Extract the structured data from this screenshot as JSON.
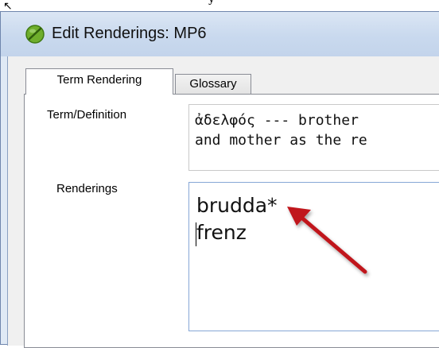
{
  "window": {
    "title": "Edit Renderings: MP6",
    "top_fragment": "y"
  },
  "tabs": [
    {
      "label": "Term Rendering",
      "active": true
    },
    {
      "label": "Glossary",
      "active": false
    }
  ],
  "term_definition": {
    "label": "Term/Definition",
    "lines": [
      "ἀδελφός --- brother",
      "and mother as the re"
    ]
  },
  "renderings": {
    "label": "Renderings",
    "lines": [
      "brudda*",
      "frenz"
    ]
  },
  "colors": {
    "titlebar": "#c9d9ee",
    "window_border": "#6f86ad",
    "annotation_arrow": "#c0141a",
    "app_icon": "#6fae2c"
  },
  "icons": {
    "app": "green-leaf-icon",
    "annotation": "red-arrow"
  }
}
